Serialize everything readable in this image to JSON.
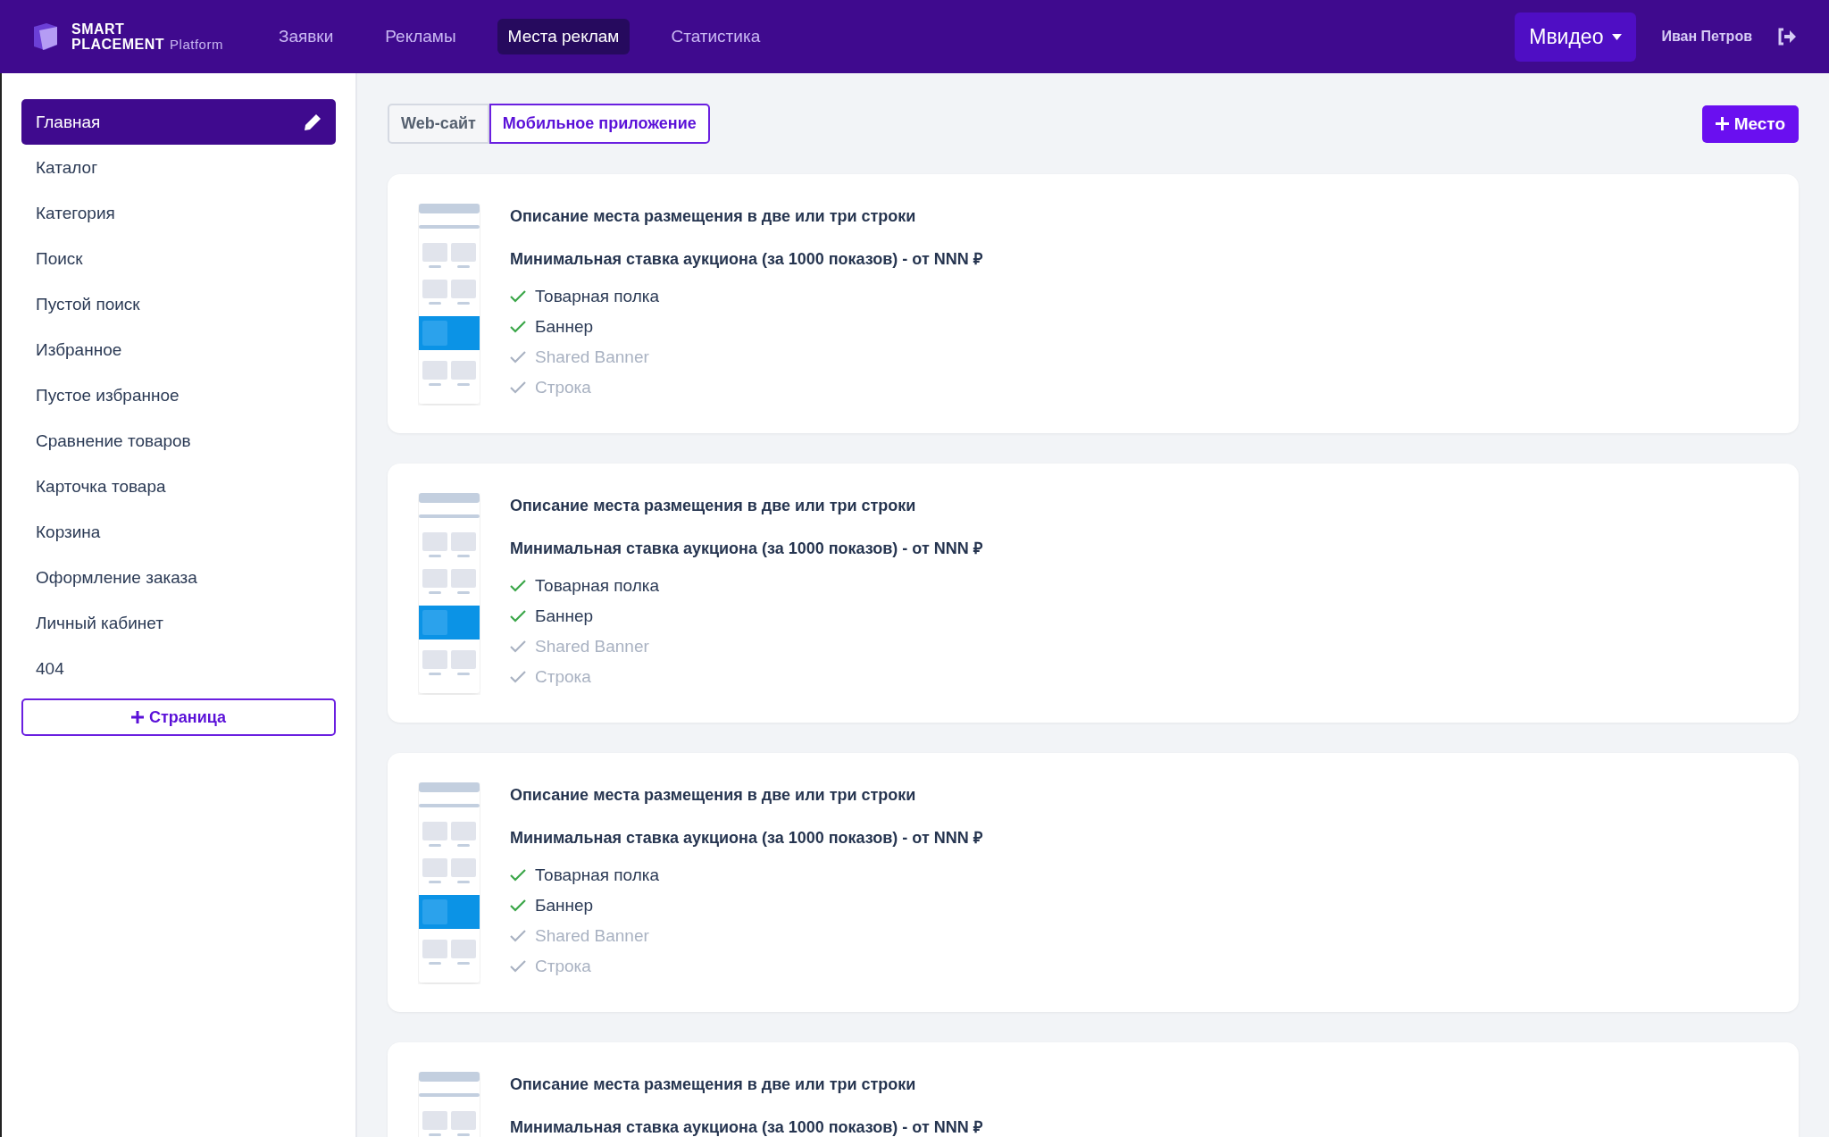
{
  "header": {
    "logo": {
      "line1": "SMART",
      "line2": "PLACEMENT",
      "suffix": "Platform"
    },
    "nav": [
      {
        "label": "Заявки",
        "selected": false
      },
      {
        "label": "Рекламы",
        "selected": false
      },
      {
        "label": "Места реклам",
        "selected": true
      },
      {
        "label": "Статистика",
        "selected": false
      }
    ],
    "brand_dropdown": "Мвидео",
    "user_name": "Иван Петров"
  },
  "sidebar": {
    "items": [
      {
        "label": "Главная",
        "selected": true
      },
      {
        "label": "Каталог",
        "selected": false
      },
      {
        "label": "Категория",
        "selected": false
      },
      {
        "label": "Поиск",
        "selected": false
      },
      {
        "label": "Пустой поиск",
        "selected": false
      },
      {
        "label": "Избранное",
        "selected": false
      },
      {
        "label": "Пустое избранное",
        "selected": false
      },
      {
        "label": "Сравнение товаров",
        "selected": false
      },
      {
        "label": "Карточка товара",
        "selected": false
      },
      {
        "label": "Корзина",
        "selected": false
      },
      {
        "label": "Оформление заказа",
        "selected": false
      },
      {
        "label": "Личный кабинет",
        "selected": false
      },
      {
        "label": "404",
        "selected": false
      }
    ],
    "add_button": "Страница"
  },
  "tabs": [
    {
      "label": "Web-сайт",
      "selected": false
    },
    {
      "label": "Мобильное приложение",
      "selected": true
    }
  ],
  "add_place_button": "Место",
  "cards": [
    {
      "title": "Описание места размещения в две или три строки",
      "bid": "Минимальная ставка аукциона (за 1000 показов) - от NNN ₽",
      "features": [
        {
          "label": "Товарная полка",
          "checked": true
        },
        {
          "label": "Баннер",
          "checked": true
        },
        {
          "label": "Shared Banner",
          "checked": false
        },
        {
          "label": "Строка",
          "checked": false
        }
      ]
    },
    {
      "title": "Описание места размещения в две или три строки",
      "bid": "Минимальная ставка аукциона (за 1000 показов) - от NNN ₽",
      "features": [
        {
          "label": "Товарная полка",
          "checked": true
        },
        {
          "label": "Баннер",
          "checked": true
        },
        {
          "label": "Shared Banner",
          "checked": false
        },
        {
          "label": "Строка",
          "checked": false
        }
      ]
    },
    {
      "title": "Описание места размещения в две или три строки",
      "bid": "Минимальная ставка аукциона (за 1000 показов) - от NNN ₽",
      "features": [
        {
          "label": "Товарная полка",
          "checked": true
        },
        {
          "label": "Баннер",
          "checked": true
        },
        {
          "label": "Shared Banner",
          "checked": false
        },
        {
          "label": "Строка",
          "checked": false
        }
      ]
    },
    {
      "title": "Описание места размещения в две или три строки",
      "bid": "Минимальная ставка аукциона (за 1000 показов) - от NNN ₽"
    }
  ]
}
